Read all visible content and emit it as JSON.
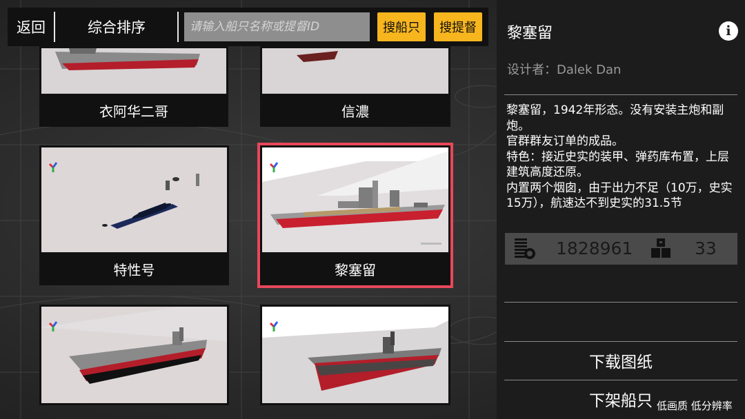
{
  "topbar": {
    "back_label": "返回",
    "sort_label": "综合排序",
    "search_placeholder": "请输入船只名称或提督ID",
    "search_value": "",
    "search_ship_label": "搜船只",
    "search_admiral_label": "搜提督"
  },
  "grid": {
    "cards": [
      {
        "name": "衣阿华二哥"
      },
      {
        "name": "信濃"
      },
      {
        "name": "特性号"
      },
      {
        "name": "黎塞留"
      },
      {
        "name": ""
      },
      {
        "name": ""
      }
    ]
  },
  "panel": {
    "title": "黎塞留",
    "designer": "设计者：Dalek Dan",
    "description": "黎塞留，1942年形态。没有安装主炮和副炮。\n官群群友订单的成品。\n特色：接近史实的装甲、弹药库布置，上层建筑高度还原。\n内置两个烟囱，由于出力不足（10万，史实15万），航速达不到史实的31.5节",
    "stat_primary": "1828961",
    "stat_secondary": "33",
    "download_label": "下载图纸",
    "delist_label": "下架船只",
    "quality_note": "低画质 低分辨率"
  },
  "colors": {
    "accent_yellow": "#f7b51e",
    "selected_border": "#e8475a",
    "hull_red": "#b31e2a"
  }
}
